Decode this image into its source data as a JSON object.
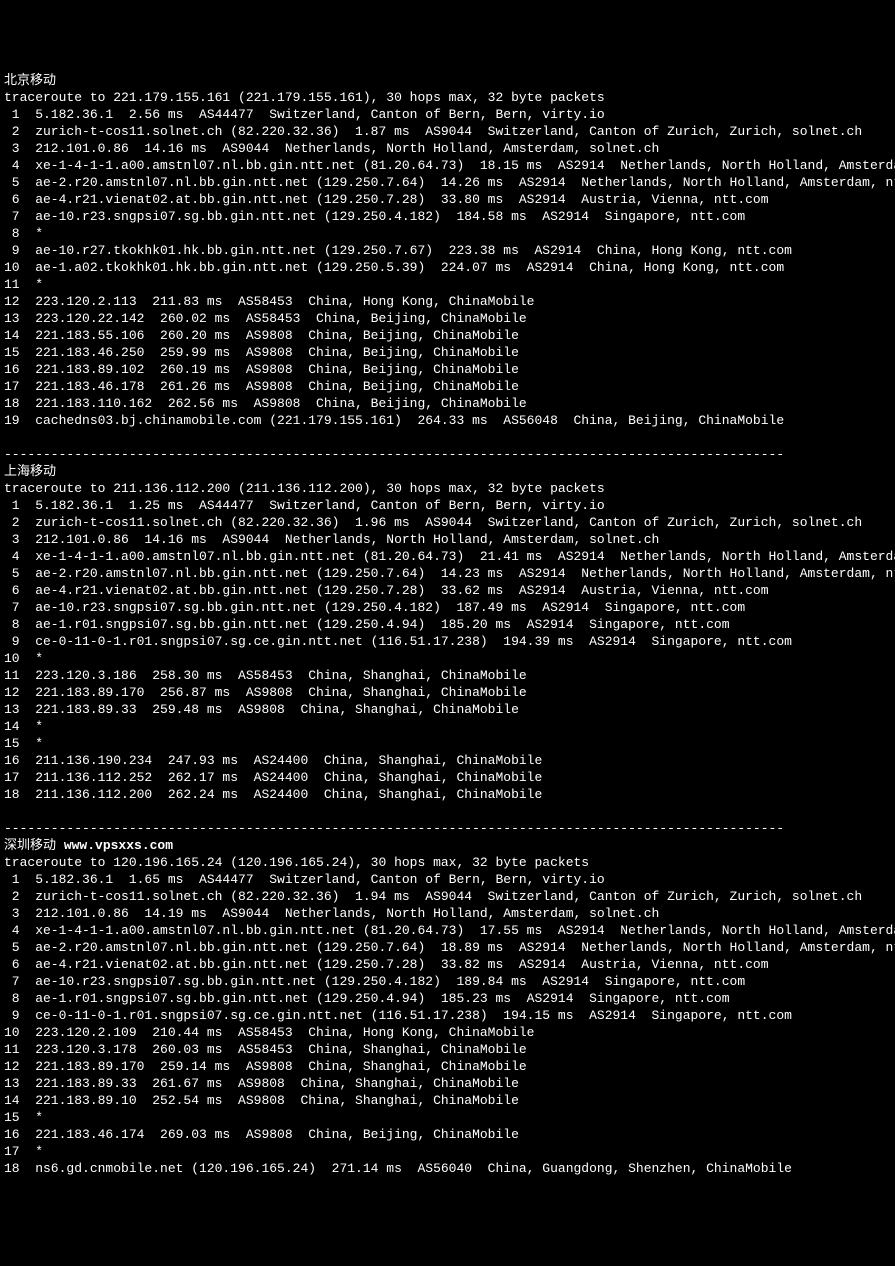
{
  "sections": [
    {
      "title": "北京移动",
      "header": "traceroute to 221.179.155.161 (221.179.155.161), 30 hops max, 32 byte packets",
      "hops": [
        " 1  5.182.36.1  2.56 ms  AS44477  Switzerland, Canton of Bern, Bern, virty.io",
        " 2  zurich-t-cos11.solnet.ch (82.220.32.36)  1.87 ms  AS9044  Switzerland, Canton of Zurich, Zurich, solnet.ch",
        " 3  212.101.0.86  14.16 ms  AS9044  Netherlands, North Holland, Amsterdam, solnet.ch",
        " 4  xe-1-4-1-1.a00.amstnl07.nl.bb.gin.ntt.net (81.20.64.73)  18.15 ms  AS2914  Netherlands, North Holland, Amsterdam, ntt.com",
        " 5  ae-2.r20.amstnl07.nl.bb.gin.ntt.net (129.250.7.64)  14.26 ms  AS2914  Netherlands, North Holland, Amsterdam, ntt.com",
        " 6  ae-4.r21.vienat02.at.bb.gin.ntt.net (129.250.7.28)  33.80 ms  AS2914  Austria, Vienna, ntt.com",
        " 7  ae-10.r23.sngpsi07.sg.bb.gin.ntt.net (129.250.4.182)  184.58 ms  AS2914  Singapore, ntt.com",
        " 8  *",
        " 9  ae-10.r27.tkokhk01.hk.bb.gin.ntt.net (129.250.7.67)  223.38 ms  AS2914  China, Hong Kong, ntt.com",
        "10  ae-1.a02.tkokhk01.hk.bb.gin.ntt.net (129.250.5.39)  224.07 ms  AS2914  China, Hong Kong, ntt.com",
        "11  *",
        "12  223.120.2.113  211.83 ms  AS58453  China, Hong Kong, ChinaMobile",
        "13  223.120.22.142  260.02 ms  AS58453  China, Beijing, ChinaMobile",
        "14  221.183.55.106  260.20 ms  AS9808  China, Beijing, ChinaMobile",
        "15  221.183.46.250  259.99 ms  AS9808  China, Beijing, ChinaMobile",
        "16  221.183.89.102  260.19 ms  AS9808  China, Beijing, ChinaMobile",
        "17  221.183.46.178  261.26 ms  AS9808  China, Beijing, ChinaMobile",
        "18  221.183.110.162  262.56 ms  AS9808  China, Beijing, ChinaMobile",
        "19  cachedns03.bj.chinamobile.com (221.179.155.161)  264.33 ms  AS56048  China, Beijing, ChinaMobile"
      ]
    },
    {
      "title": "上海移动",
      "header": "traceroute to 211.136.112.200 (211.136.112.200), 30 hops max, 32 byte packets",
      "hops": [
        " 1  5.182.36.1  1.25 ms  AS44477  Switzerland, Canton of Bern, Bern, virty.io",
        " 2  zurich-t-cos11.solnet.ch (82.220.32.36)  1.96 ms  AS9044  Switzerland, Canton of Zurich, Zurich, solnet.ch",
        " 3  212.101.0.86  14.16 ms  AS9044  Netherlands, North Holland, Amsterdam, solnet.ch",
        " 4  xe-1-4-1-1.a00.amstnl07.nl.bb.gin.ntt.net (81.20.64.73)  21.41 ms  AS2914  Netherlands, North Holland, Amsterdam, ntt.com",
        " 5  ae-2.r20.amstnl07.nl.bb.gin.ntt.net (129.250.7.64)  14.23 ms  AS2914  Netherlands, North Holland, Amsterdam, ntt.com",
        " 6  ae-4.r21.vienat02.at.bb.gin.ntt.net (129.250.7.28)  33.62 ms  AS2914  Austria, Vienna, ntt.com",
        " 7  ae-10.r23.sngpsi07.sg.bb.gin.ntt.net (129.250.4.182)  187.49 ms  AS2914  Singapore, ntt.com",
        " 8  ae-1.r01.sngpsi07.sg.bb.gin.ntt.net (129.250.4.94)  185.20 ms  AS2914  Singapore, ntt.com",
        " 9  ce-0-11-0-1.r01.sngpsi07.sg.ce.gin.ntt.net (116.51.17.238)  194.39 ms  AS2914  Singapore, ntt.com",
        "10  *",
        "11  223.120.3.186  258.30 ms  AS58453  China, Shanghai, ChinaMobile",
        "12  221.183.89.170  256.87 ms  AS9808  China, Shanghai, ChinaMobile",
        "13  221.183.89.33  259.48 ms  AS9808  China, Shanghai, ChinaMobile",
        "14  *",
        "15  *",
        "16  211.136.190.234  247.93 ms  AS24400  China, Shanghai, ChinaMobile",
        "17  211.136.112.252  262.17 ms  AS24400  China, Shanghai, ChinaMobile",
        "18  211.136.112.200  262.24 ms  AS24400  China, Shanghai, ChinaMobile"
      ]
    },
    {
      "title": "深圳移动 ",
      "title_extra": "www.vpsxxs.com",
      "header": "traceroute to 120.196.165.24 (120.196.165.24), 30 hops max, 32 byte packets",
      "hops": [
        " 1  5.182.36.1  1.65 ms  AS44477  Switzerland, Canton of Bern, Bern, virty.io",
        " 2  zurich-t-cos11.solnet.ch (82.220.32.36)  1.94 ms  AS9044  Switzerland, Canton of Zurich, Zurich, solnet.ch",
        " 3  212.101.0.86  14.19 ms  AS9044  Netherlands, North Holland, Amsterdam, solnet.ch",
        " 4  xe-1-4-1-1.a00.amstnl07.nl.bb.gin.ntt.net (81.20.64.73)  17.55 ms  AS2914  Netherlands, North Holland, Amsterdam, ntt.com",
        " 5  ae-2.r20.amstnl07.nl.bb.gin.ntt.net (129.250.7.64)  18.89 ms  AS2914  Netherlands, North Holland, Amsterdam, ntt.com",
        " 6  ae-4.r21.vienat02.at.bb.gin.ntt.net (129.250.7.28)  33.82 ms  AS2914  Austria, Vienna, ntt.com",
        " 7  ae-10.r23.sngpsi07.sg.bb.gin.ntt.net (129.250.4.182)  189.84 ms  AS2914  Singapore, ntt.com",
        " 8  ae-1.r01.sngpsi07.sg.bb.gin.ntt.net (129.250.4.94)  185.23 ms  AS2914  Singapore, ntt.com",
        " 9  ce-0-11-0-1.r01.sngpsi07.sg.ce.gin.ntt.net (116.51.17.238)  194.15 ms  AS2914  Singapore, ntt.com",
        "10  223.120.2.109  210.44 ms  AS58453  China, Hong Kong, ChinaMobile",
        "11  223.120.3.178  260.03 ms  AS58453  China, Shanghai, ChinaMobile",
        "12  221.183.89.170  259.14 ms  AS9808  China, Shanghai, ChinaMobile",
        "13  221.183.89.33  261.67 ms  AS9808  China, Shanghai, ChinaMobile",
        "14  221.183.89.10  252.54 ms  AS9808  China, Shanghai, ChinaMobile",
        "15  *",
        "16  221.183.46.174  269.03 ms  AS9808  China, Beijing, ChinaMobile",
        "17  *",
        "18  ns6.gd.cnmobile.net (120.196.165.24)  271.14 ms  AS56040  China, Guangdong, Shenzhen, ChinaMobile"
      ]
    }
  ],
  "divider": "----------------------------------------------------------------------------------------------------"
}
